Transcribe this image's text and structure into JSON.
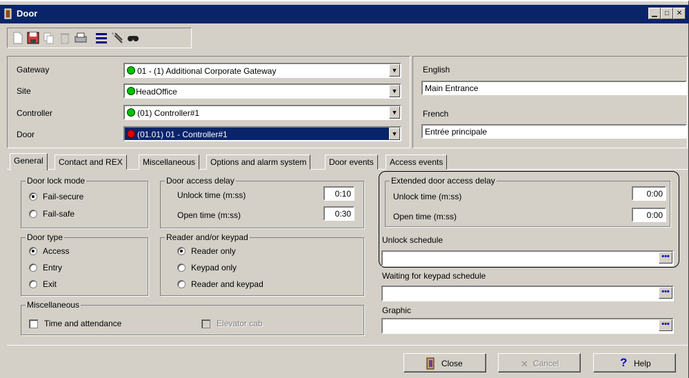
{
  "window": {
    "title": "Door"
  },
  "toolbar": {
    "buttons": [
      {
        "name": "new-icon"
      },
      {
        "name": "save-icon"
      },
      {
        "name": "copy-icon"
      },
      {
        "name": "delete-icon"
      },
      {
        "name": "print-icon"
      },
      {
        "name": "list-icon"
      },
      {
        "name": "link-icon"
      },
      {
        "name": "search-icon"
      }
    ]
  },
  "selectors": {
    "gateway": {
      "label": "Gateway",
      "value": "01 - (1)  Additional Corporate Gateway",
      "status_color": "#00c000"
    },
    "site": {
      "label": "Site",
      "value": "HeadOffice",
      "status_color": "#00c000"
    },
    "controller": {
      "label": "Controller",
      "value": "(01) Controller#1",
      "status_color": "#00c000"
    },
    "door": {
      "label": "Door",
      "value": "(01.01) 01 - Controller#1",
      "status_color": "#e00000"
    }
  },
  "names": {
    "english_label": "English",
    "english_value": "Main Entrance",
    "french_label": "French",
    "french_value": "Entrée principale"
  },
  "tabs": [
    {
      "label": "General",
      "active": true
    },
    {
      "label": "Contact and REX"
    },
    {
      "label": "Miscellaneous"
    },
    {
      "label": "Options and alarm system"
    },
    {
      "label": "Door events"
    },
    {
      "label": "Access events"
    }
  ],
  "general": {
    "door_lock_mode": {
      "caption": "Door lock mode",
      "options": [
        "Fail-secure",
        "Fail-safe"
      ],
      "selected": "Fail-secure"
    },
    "door_type": {
      "caption": "Door type",
      "options": [
        "Access",
        "Entry",
        "Exit"
      ],
      "selected": "Access"
    },
    "door_access_delay": {
      "caption": "Door access delay",
      "unlock_label": "Unlock time (m:ss)",
      "unlock_value": "0:10",
      "open_label": "Open time (m:ss)",
      "open_value": "0:30"
    },
    "reader_keypad": {
      "caption": "Reader and/or keypad",
      "options": [
        "Reader only",
        "Keypad only",
        "Reader and keypad"
      ],
      "selected": "Reader only"
    },
    "miscellaneous": {
      "caption": "Miscellaneous",
      "time_attendance": "Time and attendance",
      "elevator_cab": "Elevator cab"
    },
    "extended_delay": {
      "caption": "Extended door access delay",
      "unlock_label": "Unlock time  (m:ss)",
      "unlock_value": "0:00",
      "open_label": "Open time  (m:ss)",
      "open_value": "0:00"
    },
    "unlock_schedule": {
      "label": "Unlock schedule",
      "value": ""
    },
    "keypad_schedule": {
      "label": "Waiting for keypad schedule",
      "value": ""
    },
    "graphic": {
      "label": "Graphic",
      "value": ""
    }
  },
  "buttons": {
    "close": "Close",
    "cancel": "Cancel",
    "help": "Help"
  }
}
